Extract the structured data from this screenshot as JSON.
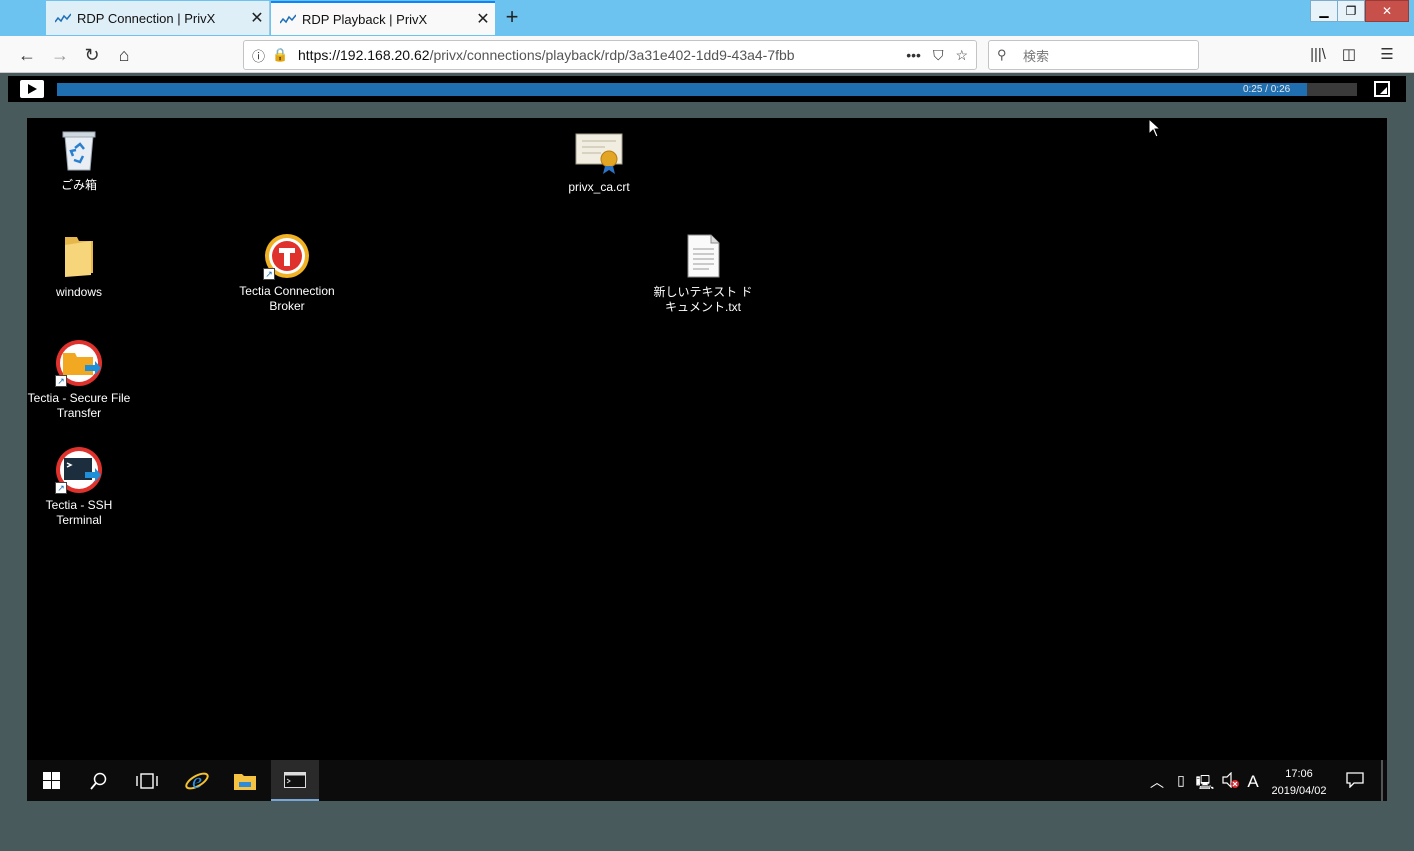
{
  "browser": {
    "tabs": [
      {
        "title": "RDP Connection | PrivX",
        "active": false
      },
      {
        "title": "RDP Playback | PrivX",
        "active": true
      }
    ],
    "url_host": "https://192.168.20.62",
    "url_path": "/privx/connections/playback/rdp/3a31e402-1dd9-43a4-7fbb",
    "search_placeholder": "検索",
    "accent": "#0a84ff"
  },
  "player": {
    "timecode": "0:25 / 0:26",
    "progress_fraction": 0.9615,
    "fill_color": "#1f6fb0"
  },
  "desktop": {
    "icons": [
      {
        "label": "ごみ箱",
        "icon": "recycle-bin-icon"
      },
      {
        "label": "privx_ca.crt",
        "icon": "certificate-icon"
      },
      {
        "label": "windows",
        "icon": "folder-icon"
      },
      {
        "label": "Tectia Connection Broker",
        "icon": "tectia-icon"
      },
      {
        "label": "新しいテキスト ドキュメント.txt",
        "icon": "text-file-icon"
      },
      {
        "label": "Tectia - Secure File Transfer",
        "icon": "tectia-sft-icon"
      },
      {
        "label": "Tectia - SSH Terminal",
        "icon": "tectia-ssh-icon"
      }
    ]
  },
  "taskbar": {
    "ime": "A",
    "time": "17:06",
    "date": "2019/04/02"
  }
}
